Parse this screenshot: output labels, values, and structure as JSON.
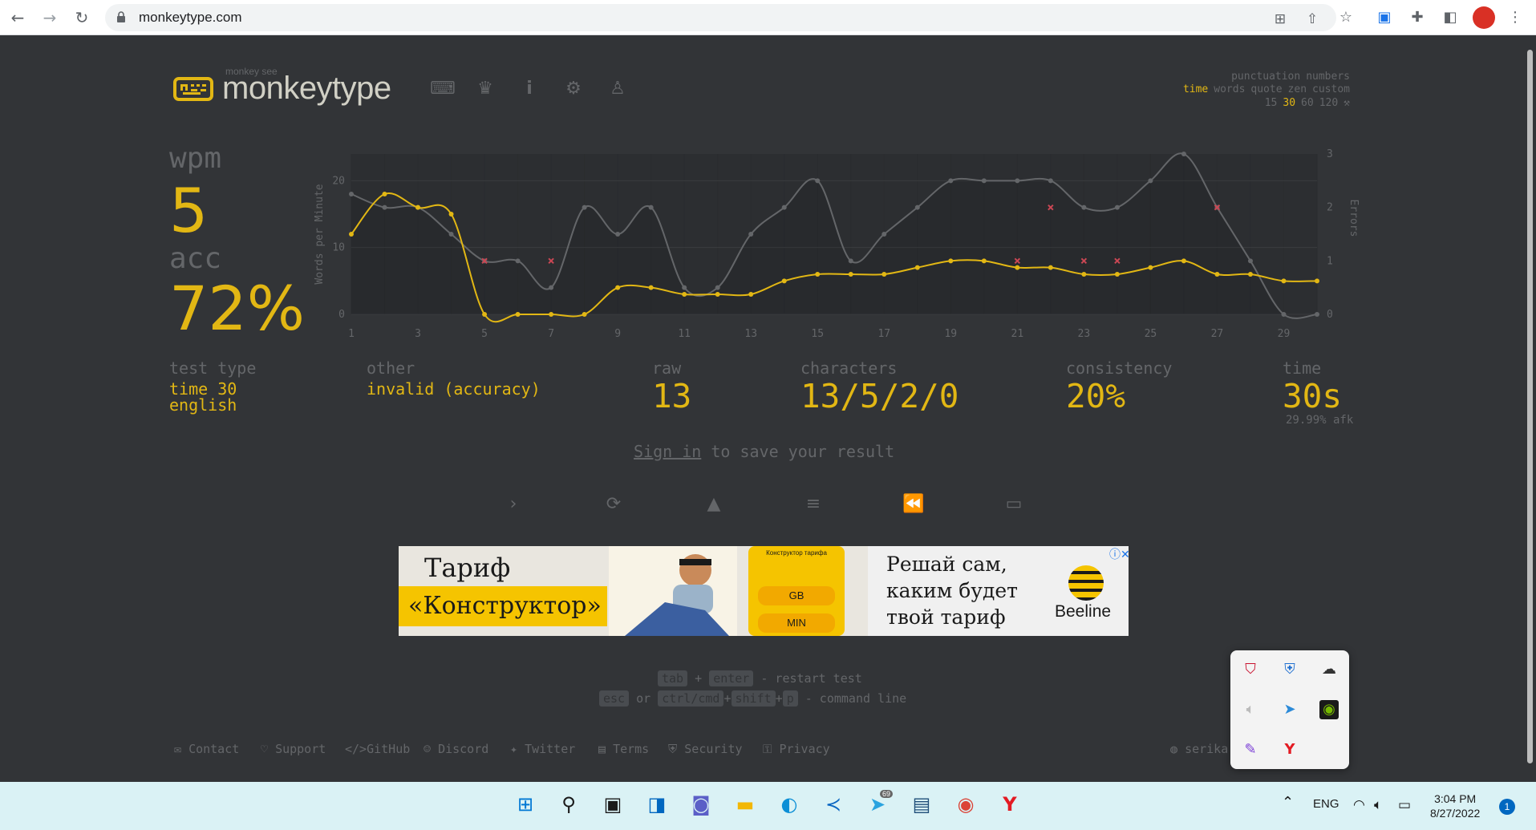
{
  "browser": {
    "url": "monkeytype.com",
    "icons": [
      "back-arrow-icon",
      "forward-arrow-icon",
      "reload-icon",
      "lock-icon",
      "translate-icon",
      "share-icon",
      "star-icon",
      "google-translate-extension-icon",
      "puzzle-icon",
      "side-panel-icon",
      "profile-avatar",
      "more-vert-icon"
    ]
  },
  "header": {
    "logo_top": "monkey see",
    "logo_text": "monkeytype",
    "nav_icons": [
      "keyboard-icon",
      "crown-icon",
      "info-icon",
      "gear-icon",
      "user-icon"
    ]
  },
  "config": {
    "row1": [
      "punctuation",
      "numbers"
    ],
    "row2": [
      "time",
      "words",
      "quote",
      "zen",
      "custom"
    ],
    "row2_active": "time",
    "row3": [
      "15",
      "30",
      "60",
      "120"
    ],
    "row3_active": "30",
    "row3_icon": "tools-icon"
  },
  "result": {
    "wpm_label": "wpm",
    "wpm_value": "5",
    "acc_label": "acc",
    "acc_value": "72%",
    "test_type_label": "test type",
    "test_type_line1": "time 30",
    "test_type_line2": "english",
    "other_label": "other",
    "other_value": "invalid (accuracy)",
    "raw_label": "raw",
    "raw_value": "13",
    "characters_label": "characters",
    "characters_value": "13/5/2/0",
    "consistency_label": "consistency",
    "consistency_value": "20%",
    "time_label": "time",
    "time_value": "30s",
    "afk_value": "29.99% afk"
  },
  "chart_data": {
    "type": "line",
    "x": [
      1,
      2,
      3,
      4,
      5,
      6,
      7,
      8,
      9,
      10,
      11,
      12,
      13,
      14,
      15,
      16,
      17,
      18,
      19,
      20,
      21,
      22,
      23,
      24,
      25,
      26,
      27,
      28,
      29,
      30
    ],
    "ylabel": "Words per Minute",
    "y2label": "Errors",
    "ylim": [
      0,
      24
    ],
    "y2lim": [
      0,
      3
    ],
    "x_ticks": [
      1,
      3,
      5,
      7,
      9,
      11,
      13,
      15,
      17,
      19,
      21,
      23,
      25,
      27,
      29
    ],
    "y_ticks": [
      0,
      10,
      20
    ],
    "y2_ticks": [
      0,
      1,
      2,
      3
    ],
    "series": [
      {
        "values": [
          12,
          18,
          16,
          15,
          0,
          0,
          0,
          0,
          4,
          4,
          3,
          3,
          3,
          5,
          6,
          6,
          6,
          7,
          8,
          8,
          7,
          7,
          6,
          6,
          7,
          8,
          6,
          6,
          5,
          5
        ],
        "color": "#e2b714"
      },
      {
        "values": [
          18,
          16,
          16,
          12,
          8,
          8,
          4,
          16,
          12,
          16,
          4,
          4,
          12,
          16,
          20,
          8,
          12,
          16,
          20,
          20,
          20,
          20,
          16,
          16,
          20,
          24,
          16,
          8,
          0,
          0
        ],
        "color": "#646669"
      }
    ],
    "errors": [
      {
        "x": 5,
        "y": 1
      },
      {
        "x": 7,
        "y": 1
      },
      {
        "x": 21,
        "y": 1
      },
      {
        "x": 22,
        "y": 2
      },
      {
        "x": 23,
        "y": 1
      },
      {
        "x": 24,
        "y": 1
      },
      {
        "x": 27,
        "y": 2
      }
    ],
    "error_color": "#ca4754"
  },
  "signin": {
    "link": "Sign in",
    "rest": " to save your result"
  },
  "actions": [
    "next-test-icon",
    "restart-icon",
    "warning-icon",
    "words-history-icon",
    "replay-icon",
    "screenshot-icon"
  ],
  "ad": {
    "title1": "Тариф",
    "title2": "«Конструктор»",
    "phone_header": "Конструктор тарифа",
    "pill1": "GB",
    "pill2": "MIN",
    "right_line1": "Решай сам,",
    "right_line2": "каким будет",
    "right_line3": "твой тариф",
    "brand": "Beeline"
  },
  "hints": {
    "tab": "tab",
    "plus": "+",
    "enter": "enter",
    "restart": "- restart test",
    "esc": "esc",
    "or": "or",
    "ctrl": "ctrl/cmd",
    "shift": "shift",
    "p": "p",
    "command": "- command line"
  },
  "footer": {
    "links": [
      "Contact",
      "Support",
      "GitHub",
      "Discord",
      "Twitter",
      "Terms",
      "Security",
      "Privacy"
    ],
    "theme": "serika"
  },
  "taskbar": {
    "lang": "ENG",
    "time": "3:04 PM",
    "date": "8/27/2022",
    "notifications": "1",
    "telegram_badge": "69"
  }
}
